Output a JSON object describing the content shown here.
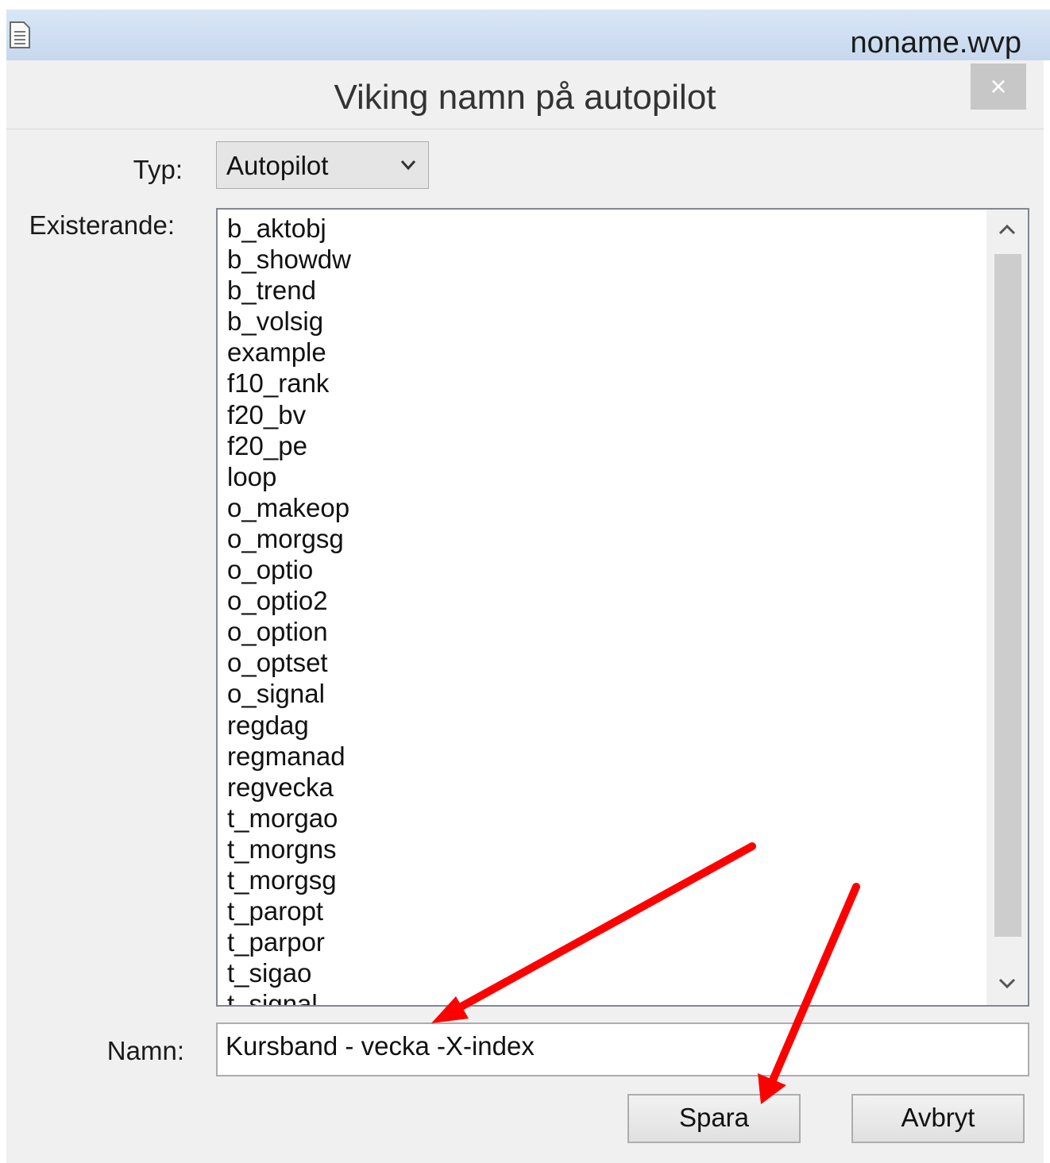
{
  "parent_window": {
    "title": "noname.wvp"
  },
  "dialog": {
    "title": "Viking namn på autopilot",
    "close_label": "×",
    "typ": {
      "label": "Typ:",
      "value": "Autopilot"
    },
    "existerande": {
      "label": "Existerande:",
      "items": [
        "b_aktobj",
        "b_showdw",
        "b_trend",
        "b_volsig",
        "example",
        "f10_rank",
        "f20_bv",
        "f20_pe",
        "loop",
        "o_makeop",
        "o_morgsg",
        "o_optio",
        "o_optio2",
        "o_option",
        "o_optset",
        "o_signal",
        "regdag",
        "regmanad",
        "regvecka",
        "t_morgao",
        "t_morgns",
        "t_morgsg",
        "t_paropt",
        "t_parpor",
        "t_sigao",
        "t_signal"
      ]
    },
    "namn": {
      "label": "Namn:",
      "value": "Kursband - vecka -X-index"
    },
    "buttons": {
      "save": "Spara",
      "cancel": "Avbryt"
    }
  },
  "annotation_color": "#ff0000",
  "icons": {
    "document": "document-icon",
    "close": "close-icon",
    "dropdown": "chevron-down-icon",
    "scroll_up": "chevron-up-icon",
    "scroll_down": "chevron-down-icon"
  }
}
